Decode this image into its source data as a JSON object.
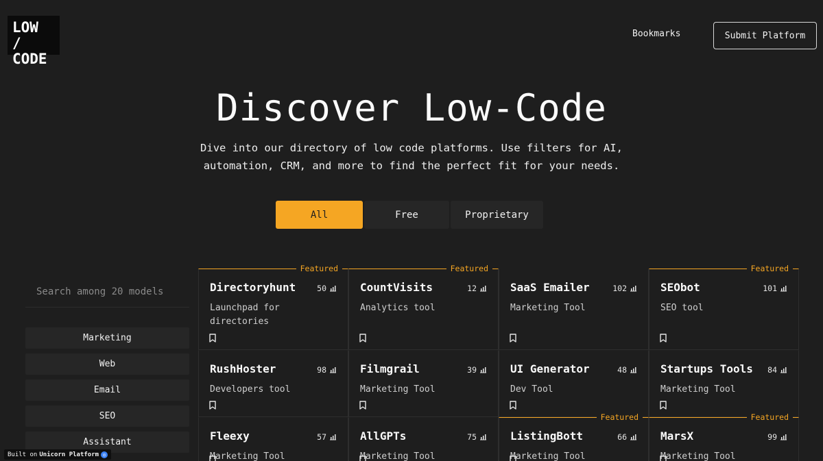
{
  "brand": {
    "line1": "LOW /",
    "line2": "CODE"
  },
  "nav": {
    "bookmarks": "Bookmarks",
    "submit": "Submit Platform"
  },
  "hero": {
    "title": "Discover Low-Code",
    "subtitle_line1": "Dive into our directory of low code platforms. Use filters for AI,",
    "subtitle_line2": "automation, CRM, and more to find the perfect fit for your needs."
  },
  "filters": [
    "All",
    "Free",
    "Proprietary"
  ],
  "search": {
    "placeholder": "Search among 20 models"
  },
  "categories": [
    "Marketing",
    "Web",
    "Email",
    "SEO",
    "Assistant"
  ],
  "featured_label": "Featured",
  "accent_color": "#f5a623",
  "cards": [
    {
      "name": "Directoryhunt",
      "count": "50",
      "desc": "Launchpad for directories",
      "featured": true
    },
    {
      "name": "CountVisits",
      "count": "12",
      "desc": "Analytics tool",
      "featured": true
    },
    {
      "name": "SaaS Emailer",
      "count": "102",
      "desc": "Marketing Tool",
      "featured": false
    },
    {
      "name": "SEObot",
      "count": "101",
      "desc": "SEO tool",
      "featured": true
    },
    {
      "name": "RushHoster",
      "count": "98",
      "desc": "Developers tool",
      "featured": false
    },
    {
      "name": "Filmgrail",
      "count": "39",
      "desc": "Marketing Tool",
      "featured": false
    },
    {
      "name": "UI Generator",
      "count": "48",
      "desc": "Dev Tool",
      "featured": false
    },
    {
      "name": "Startups Tools",
      "count": "84",
      "desc": "Marketing Tool",
      "featured": false
    },
    {
      "name": "Fleexy",
      "count": "57",
      "desc": "Marketing Tool",
      "featured": false
    },
    {
      "name": "AllGPTs",
      "count": "75",
      "desc": "Marketing Tool",
      "featured": false
    },
    {
      "name": "ListingBott",
      "count": "66",
      "desc": "Marketing Tool",
      "featured": true
    },
    {
      "name": "MarsX",
      "count": "99",
      "desc": "Marketing Tool",
      "featured": true
    }
  ],
  "badge": {
    "prefix": "Built on",
    "name": "Unicorn Platform"
  }
}
